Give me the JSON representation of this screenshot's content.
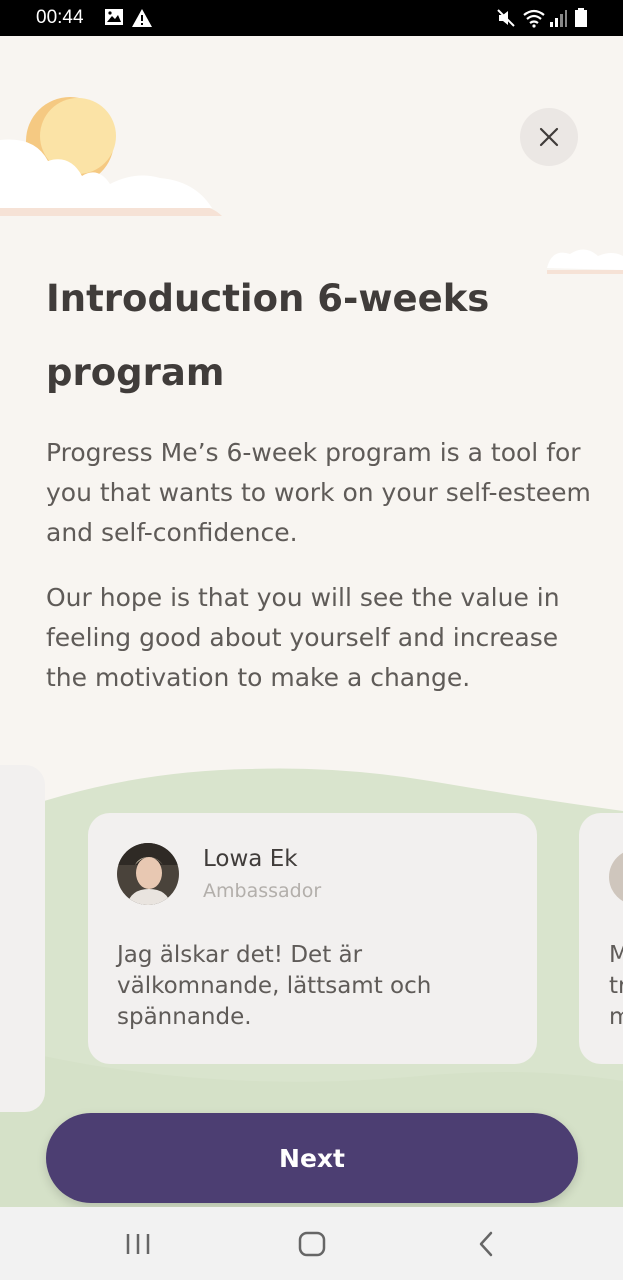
{
  "status_bar": {
    "time": "00:44"
  },
  "title": "Introduction 6-weeks program",
  "paragraphs": [
    "Progress Me’s 6-week program is a tool for you that wants to work on your self-esteem and self-confidence.",
    "Our hope is that you will see the value in feeling good about yourself and increase the motivation to make a change."
  ],
  "testimonial": {
    "name": "Lowa Ek",
    "role": "Ambassador",
    "quote": "Jag älskar det! Det är välkomnande, lättsamt och spännande."
  },
  "next_card_partial_text": [
    "M",
    "tr",
    "m"
  ],
  "next_button": {
    "label": "Next"
  },
  "colors": {
    "background": "#f8f5f1",
    "hills": "#d9e4cd",
    "card": "#f2f0ef",
    "primary_button": "#4c3e72",
    "sun": "#fbe3a6",
    "title_text": "#403c3a"
  },
  "icons": {
    "close": "close-icon",
    "nav_recents": "recents-icon",
    "nav_home": "home-icon",
    "nav_back": "back-icon"
  }
}
